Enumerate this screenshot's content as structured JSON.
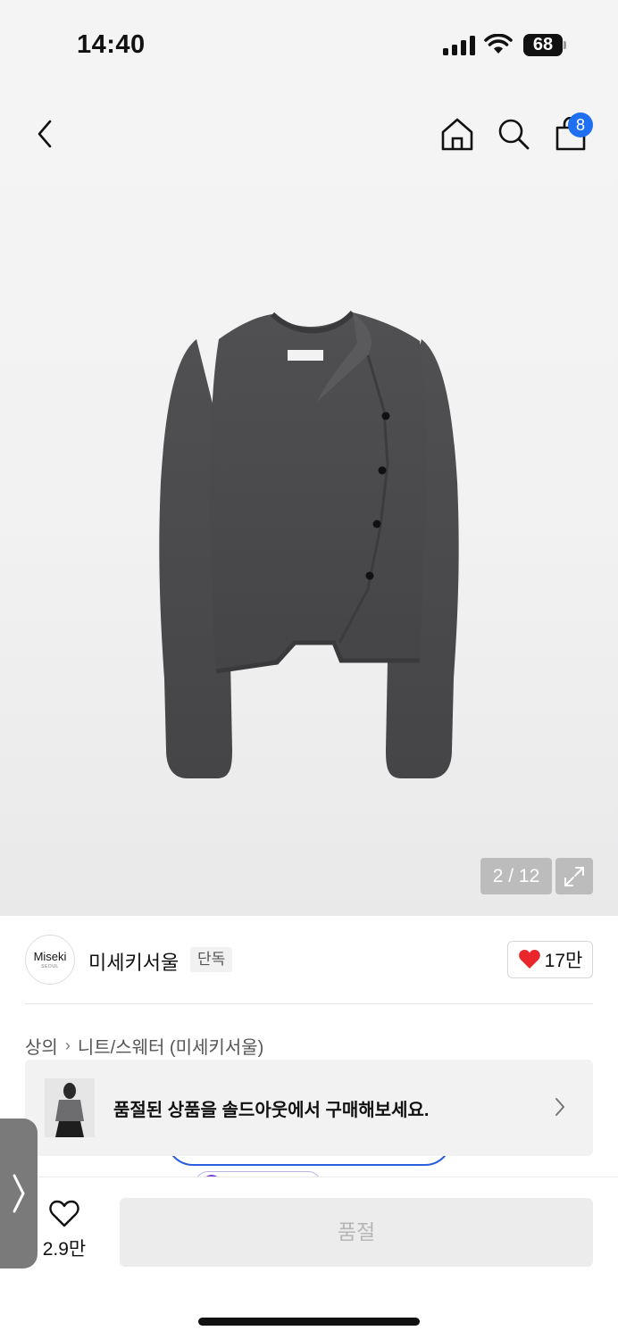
{
  "status_bar": {
    "time": "14:40",
    "battery": "68"
  },
  "nav": {
    "cart_count": "8"
  },
  "gallery": {
    "counter": "2 / 12"
  },
  "brand": {
    "logo_text": "Miseki",
    "logo_sub": "SEOUL",
    "name": "미세키서울",
    "tag": "단독",
    "likes": "17만"
  },
  "breadcrumb": {
    "category": "상의",
    "subcategory": "니트/스웨터 (미세키서울)"
  },
  "soldout_banner": {
    "text": "품절된 상품을 솔드아웃에서 구매해보세요."
  },
  "bottom_bar": {
    "wish_count": "2.9만",
    "buy_label": "품절"
  },
  "colors": {
    "accent": "#1f6ff2",
    "heart": "#e8262c",
    "disabled_bg": "#ececec"
  }
}
